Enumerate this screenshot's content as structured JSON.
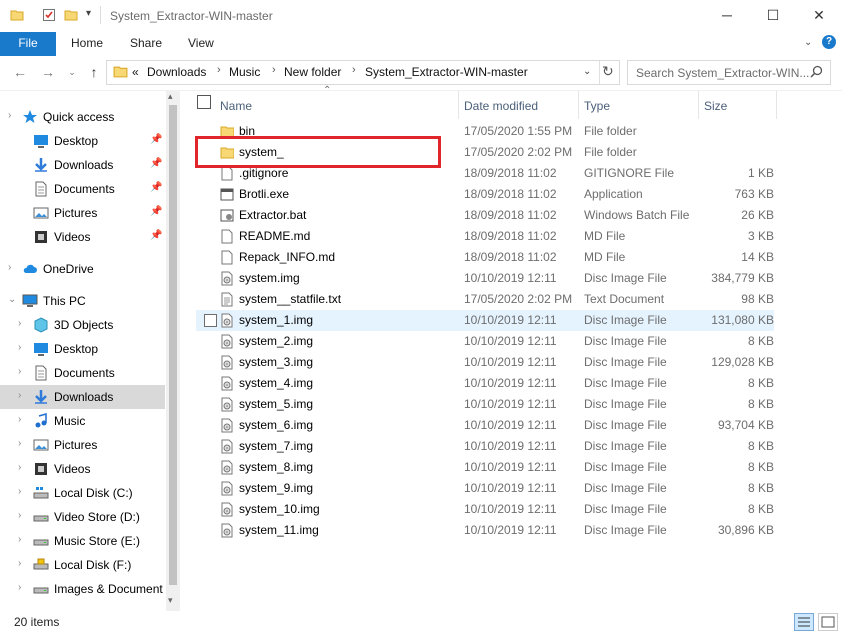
{
  "window": {
    "title": "System_Extractor-WIN-master",
    "minimize_glyph": "─",
    "maximize_glyph": "☐",
    "close_glyph": "✕"
  },
  "ribbon": {
    "tabs": [
      "File",
      "Home",
      "Share",
      "View"
    ],
    "help_glyph": "?"
  },
  "address": {
    "overflow": "«",
    "crumbs": [
      "Downloads",
      "Music",
      "New folder",
      "System_Extractor-WIN-master"
    ],
    "search_placeholder": "Search System_Extractor-WIN..."
  },
  "nav": {
    "items": [
      {
        "label": "Quick access",
        "icon": "star-icon",
        "pinned": false
      },
      {
        "label": "Desktop",
        "icon": "desktop-icon",
        "pinned": true
      },
      {
        "label": "Downloads",
        "icon": "download-icon",
        "pinned": true
      },
      {
        "label": "Documents",
        "icon": "documents-icon",
        "pinned": true
      },
      {
        "label": "Pictures",
        "icon": "pictures-icon",
        "pinned": true
      },
      {
        "label": "Videos",
        "icon": "videos-icon",
        "pinned": true
      },
      {
        "label": "OneDrive",
        "icon": "cloud-icon",
        "pinned": false
      },
      {
        "label": "This PC",
        "icon": "computer-icon",
        "pinned": false
      },
      {
        "label": "3D Objects",
        "icon": "cube-icon",
        "pinned": false
      },
      {
        "label": "Desktop",
        "icon": "desktop-icon",
        "pinned": false
      },
      {
        "label": "Documents",
        "icon": "documents-icon",
        "pinned": false
      },
      {
        "label": "Downloads",
        "icon": "download-icon",
        "pinned": false
      },
      {
        "label": "Music",
        "icon": "music-icon",
        "pinned": false
      },
      {
        "label": "Pictures",
        "icon": "pictures-icon",
        "pinned": false
      },
      {
        "label": "Videos",
        "icon": "videos-icon",
        "pinned": false
      },
      {
        "label": "Local Disk (C:)",
        "icon": "drive-windows-icon",
        "pinned": false
      },
      {
        "label": "Video Store (D:)",
        "icon": "drive-icon",
        "pinned": false
      },
      {
        "label": "Music Store (E:)",
        "icon": "drive-icon",
        "pinned": false
      },
      {
        "label": "Local Disk (F:)",
        "icon": "drive-locked-icon",
        "pinned": false
      },
      {
        "label": "Images & Document",
        "icon": "drive-icon",
        "pinned": false
      }
    ]
  },
  "columns": {
    "name": "Name",
    "date": "Date modified",
    "type": "Type",
    "size": "Size"
  },
  "files": [
    {
      "name": "bin",
      "date": "17/05/2020 1:55 PM",
      "type": "File folder",
      "size": "",
      "icon": "folder-icon"
    },
    {
      "name": "system_",
      "date": "17/05/2020 2:02 PM",
      "type": "File folder",
      "size": "",
      "icon": "folder-icon"
    },
    {
      "name": ".gitignore",
      "date": "18/09/2018 11:02",
      "type": "GITIGNORE File",
      "size": "1 KB",
      "icon": "file-icon"
    },
    {
      "name": "Brotli.exe",
      "date": "18/09/2018 11:02",
      "type": "Application",
      "size": "763 KB",
      "icon": "exe-icon"
    },
    {
      "name": "Extractor.bat",
      "date": "18/09/2018 11:02",
      "type": "Windows Batch File",
      "size": "26 KB",
      "icon": "batch-icon"
    },
    {
      "name": "README.md",
      "date": "18/09/2018 11:02",
      "type": "MD File",
      "size": "3 KB",
      "icon": "file-icon"
    },
    {
      "name": "Repack_INFO.md",
      "date": "18/09/2018 11:02",
      "type": "MD File",
      "size": "14 KB",
      "icon": "file-icon"
    },
    {
      "name": "system.img",
      "date": "10/10/2019 12:11",
      "type": "Disc Image File",
      "size": "384,779 KB",
      "icon": "disc-image-icon"
    },
    {
      "name": "system__statfile.txt",
      "date": "17/05/2020 2:02 PM",
      "type": "Text Document",
      "size": "98 KB",
      "icon": "text-file-icon"
    },
    {
      "name": "system_1.img",
      "date": "10/10/2019 12:11",
      "type": "Disc Image File",
      "size": "131,080 KB",
      "icon": "disc-image-icon"
    },
    {
      "name": "system_2.img",
      "date": "10/10/2019 12:11",
      "type": "Disc Image File",
      "size": "8 KB",
      "icon": "disc-image-icon"
    },
    {
      "name": "system_3.img",
      "date": "10/10/2019 12:11",
      "type": "Disc Image File",
      "size": "129,028 KB",
      "icon": "disc-image-icon"
    },
    {
      "name": "system_4.img",
      "date": "10/10/2019 12:11",
      "type": "Disc Image File",
      "size": "8 KB",
      "icon": "disc-image-icon"
    },
    {
      "name": "system_5.img",
      "date": "10/10/2019 12:11",
      "type": "Disc Image File",
      "size": "8 KB",
      "icon": "disc-image-icon"
    },
    {
      "name": "system_6.img",
      "date": "10/10/2019 12:11",
      "type": "Disc Image File",
      "size": "93,704 KB",
      "icon": "disc-image-icon"
    },
    {
      "name": "system_7.img",
      "date": "10/10/2019 12:11",
      "type": "Disc Image File",
      "size": "8 KB",
      "icon": "disc-image-icon"
    },
    {
      "name": "system_8.img",
      "date": "10/10/2019 12:11",
      "type": "Disc Image File",
      "size": "8 KB",
      "icon": "disc-image-icon"
    },
    {
      "name": "system_9.img",
      "date": "10/10/2019 12:11",
      "type": "Disc Image File",
      "size": "8 KB",
      "icon": "disc-image-icon"
    },
    {
      "name": "system_10.img",
      "date": "10/10/2019 12:11",
      "type": "Disc Image File",
      "size": "8 KB",
      "icon": "disc-image-icon"
    },
    {
      "name": "system_11.img",
      "date": "10/10/2019 12:11",
      "type": "Disc Image File",
      "size": "30,896 KB",
      "icon": "disc-image-icon"
    }
  ],
  "status": {
    "item_count": "20 items"
  },
  "colors": {
    "accent": "#1979ca",
    "highlight_box": "#e0262a",
    "hover_row": "#e5f3ff",
    "nav_selected": "#d9d9d9"
  }
}
